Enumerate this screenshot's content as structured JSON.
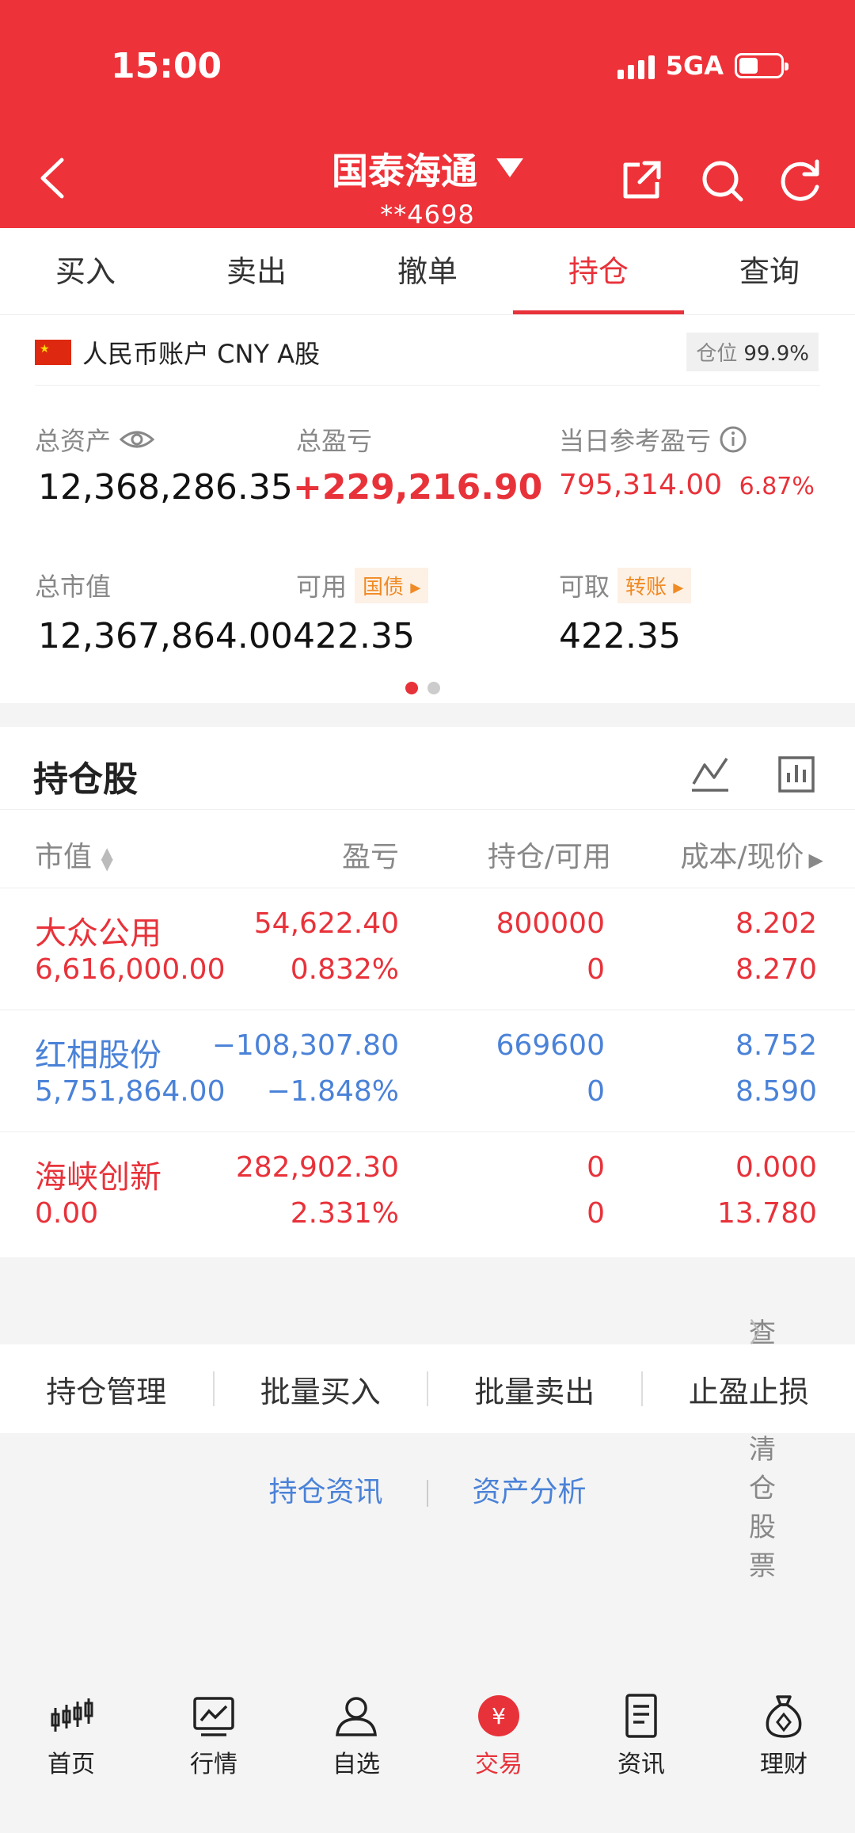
{
  "status_bar": {
    "time": "15:00",
    "network": "5GA"
  },
  "header": {
    "broker": "国泰海通",
    "account": "**4698"
  },
  "tabs": [
    {
      "label": "买入"
    },
    {
      "label": "卖出"
    },
    {
      "label": "撤单"
    },
    {
      "label": "持仓",
      "active": true
    },
    {
      "label": "查询"
    }
  ],
  "account": {
    "name": "人民币账户 CNY A股",
    "position_label": "仓位",
    "position_value": "99.9%",
    "total_assets_label": "总资产",
    "total_assets": "12,368,286.35",
    "total_pnl_label": "总盈亏",
    "total_pnl": "+229,216.90",
    "day_pnl_label": "当日参考盈亏",
    "day_pnl": "795,314.00",
    "day_pnl_pct": "6.87%",
    "market_value_label": "总市值",
    "market_value": "12,367,864.00",
    "available_label": "可用",
    "available_tag": "国债",
    "available": "422.35",
    "withdrawable_label": "可取",
    "withdrawable_tag": "转账",
    "withdrawable": "422.35"
  },
  "holdings": {
    "title": "持仓股",
    "headers": {
      "market_value": "市值",
      "pnl": "盈亏",
      "position": "持仓/可用",
      "cost": "成本/现价"
    },
    "rows": [
      {
        "name": "大众公用",
        "market_value": "6,616,000.00",
        "pnl": "54,622.40",
        "pnl_pct": "0.832%",
        "hold": "800000",
        "avail": "0",
        "cost": "8.202",
        "price": "8.270",
        "color": "red"
      },
      {
        "name": "红相股份",
        "market_value": "5,751,864.00",
        "pnl": "−108,307.80",
        "pnl_pct": "−1.848%",
        "hold": "669600",
        "avail": "0",
        "cost": "8.752",
        "price": "8.590",
        "color": "blue"
      },
      {
        "name": "海峡创新",
        "market_value": "0.00",
        "pnl": "282,902.30",
        "pnl_pct": "2.331%",
        "hold": "0",
        "avail": "0",
        "cost": "0.000",
        "price": "13.780",
        "color": "red"
      }
    ],
    "cleared_link": "查看已清仓股票"
  },
  "actions": [
    "持仓管理",
    "批量买入",
    "批量卖出",
    "止盈止损"
  ],
  "links": [
    "持仓资讯",
    "资产分析"
  ],
  "nav": [
    {
      "label": "首页",
      "icon": "candlestick-icon"
    },
    {
      "label": "行情",
      "icon": "chart-icon"
    },
    {
      "label": "自选",
      "icon": "user-icon"
    },
    {
      "label": "交易",
      "icon": "yuan-icon",
      "active": true
    },
    {
      "label": "资讯",
      "icon": "document-icon"
    },
    {
      "label": "理财",
      "icon": "moneybag-icon"
    }
  ],
  "colors": {
    "brand_red": "#ee3239",
    "up": "#e8323a",
    "down": "#4a82d8",
    "tag": "#f08a24"
  }
}
